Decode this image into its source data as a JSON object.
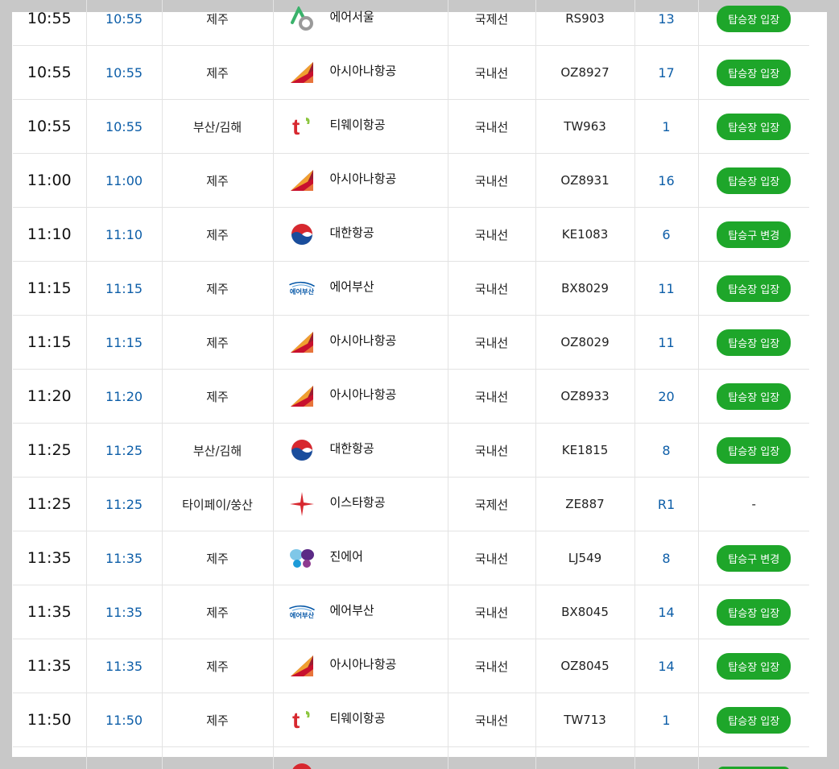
{
  "rows": [
    {
      "sched": "10:55",
      "est": "10:55",
      "dest": "제주",
      "logo": "airseoul",
      "airline": "에어서울",
      "type": "국제선",
      "flight": "RS903",
      "gate": "13",
      "status": "탑승장 입장"
    },
    {
      "sched": "10:55",
      "est": "10:55",
      "dest": "제주",
      "logo": "asiana",
      "airline": "아시아나항공",
      "type": "국내선",
      "flight": "OZ8927",
      "gate": "17",
      "status": "탑승장 입장"
    },
    {
      "sched": "10:55",
      "est": "10:55",
      "dest": "부산/김해",
      "logo": "tway",
      "airline": "티웨이항공",
      "type": "국내선",
      "flight": "TW963",
      "gate": "1",
      "status": "탑승장 입장"
    },
    {
      "sched": "11:00",
      "est": "11:00",
      "dest": "제주",
      "logo": "asiana",
      "airline": "아시아나항공",
      "type": "국내선",
      "flight": "OZ8931",
      "gate": "16",
      "status": "탑승장 입장"
    },
    {
      "sched": "11:10",
      "est": "11:10",
      "dest": "제주",
      "logo": "koreanair",
      "airline": "대한항공",
      "type": "국내선",
      "flight": "KE1083",
      "gate": "6",
      "status": "탑승구 변경"
    },
    {
      "sched": "11:15",
      "est": "11:15",
      "dest": "제주",
      "logo": "airbusan",
      "airline": "에어부산",
      "type": "국내선",
      "flight": "BX8029",
      "gate": "11",
      "status": "탑승장 입장"
    },
    {
      "sched": "11:15",
      "est": "11:15",
      "dest": "제주",
      "logo": "asiana",
      "airline": "아시아나항공",
      "type": "국내선",
      "flight": "OZ8029",
      "gate": "11",
      "status": "탑승장 입장"
    },
    {
      "sched": "11:20",
      "est": "11:20",
      "dest": "제주",
      "logo": "asiana",
      "airline": "아시아나항공",
      "type": "국내선",
      "flight": "OZ8933",
      "gate": "20",
      "status": "탑승장 입장"
    },
    {
      "sched": "11:25",
      "est": "11:25",
      "dest": "부산/김해",
      "logo": "koreanair",
      "airline": "대한항공",
      "type": "국내선",
      "flight": "KE1815",
      "gate": "8",
      "status": "탑승장 입장"
    },
    {
      "sched": "11:25",
      "est": "11:25",
      "dest": "타이페이/쑹산",
      "logo": "eastar",
      "airline": "이스타항공",
      "type": "국제선",
      "flight": "ZE887",
      "gate": "R1",
      "status": "-"
    },
    {
      "sched": "11:35",
      "est": "11:35",
      "dest": "제주",
      "logo": "jinair",
      "airline": "진에어",
      "type": "국내선",
      "flight": "LJ549",
      "gate": "8",
      "status": "탑승구 변경"
    },
    {
      "sched": "11:35",
      "est": "11:35",
      "dest": "제주",
      "logo": "airbusan",
      "airline": "에어부산",
      "type": "국내선",
      "flight": "BX8045",
      "gate": "14",
      "status": "탑승장 입장"
    },
    {
      "sched": "11:35",
      "est": "11:35",
      "dest": "제주",
      "logo": "asiana",
      "airline": "아시아나항공",
      "type": "국내선",
      "flight": "OZ8045",
      "gate": "14",
      "status": "탑승장 입장"
    },
    {
      "sched": "11:50",
      "est": "11:50",
      "dest": "제주",
      "logo": "tway",
      "airline": "티웨이항공",
      "type": "국내선",
      "flight": "TW713",
      "gate": "1",
      "status": "탑승장 입장"
    },
    {
      "sched": "",
      "est": "",
      "dest": "",
      "logo": "koreanair",
      "airline": "",
      "type": "",
      "flight": "",
      "gate": "",
      "status": ""
    }
  ],
  "logo_text": {
    "airbusan": "에어부산"
  },
  "colors": {
    "status_button": "#1ea62a",
    "link_blue": "#0d5ea8"
  }
}
